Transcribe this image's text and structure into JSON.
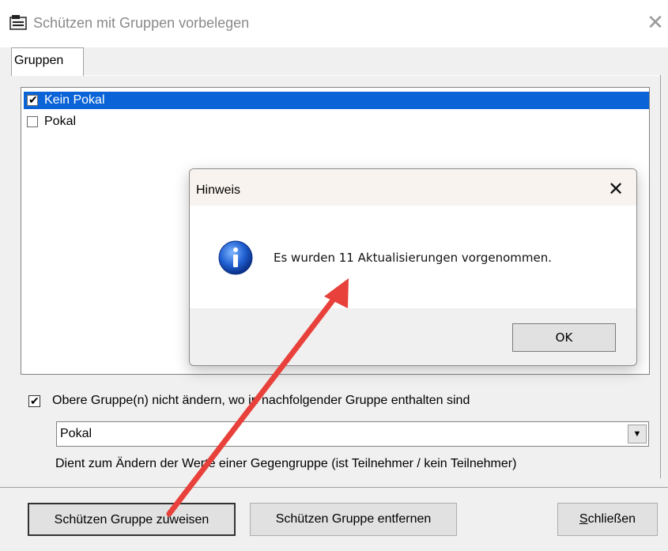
{
  "window": {
    "title": "Schützen mit Gruppen vorbelegen",
    "close_glyph": "✕"
  },
  "tabs": [
    {
      "label": "Gruppen"
    }
  ],
  "group_list": {
    "items": [
      {
        "label": "Kein Pokal",
        "checked": true,
        "selected": true
      },
      {
        "label": "Pokal",
        "checked": false,
        "selected": false
      }
    ],
    "selection_color": "#0a64d8"
  },
  "options": {
    "keep_upper_checkbox_label": "Obere Gruppe(n) nicht ändern, wo in nachfolgender Gruppe enthalten sind",
    "keep_upper_checked": true,
    "group_select_value": "Pokal",
    "hint_text": "Dient zum Ändern der Werte einer Gegengruppe (ist Teilnehmer / kein Teilnehmer)"
  },
  "buttons": {
    "assign": "Schützen Gruppe zuweisen",
    "remove": "Schützen Gruppe entfernen",
    "close_prefix": "S",
    "close_rest": "chließen"
  },
  "dialog": {
    "title": "Hinweis",
    "close_glyph": "✕",
    "icon": "info-icon",
    "message": "Es wurden 11 Aktualisierungen vorgenommen.",
    "ok_label": "OK"
  },
  "annotation": {
    "arrow_color": "#e8403a"
  }
}
